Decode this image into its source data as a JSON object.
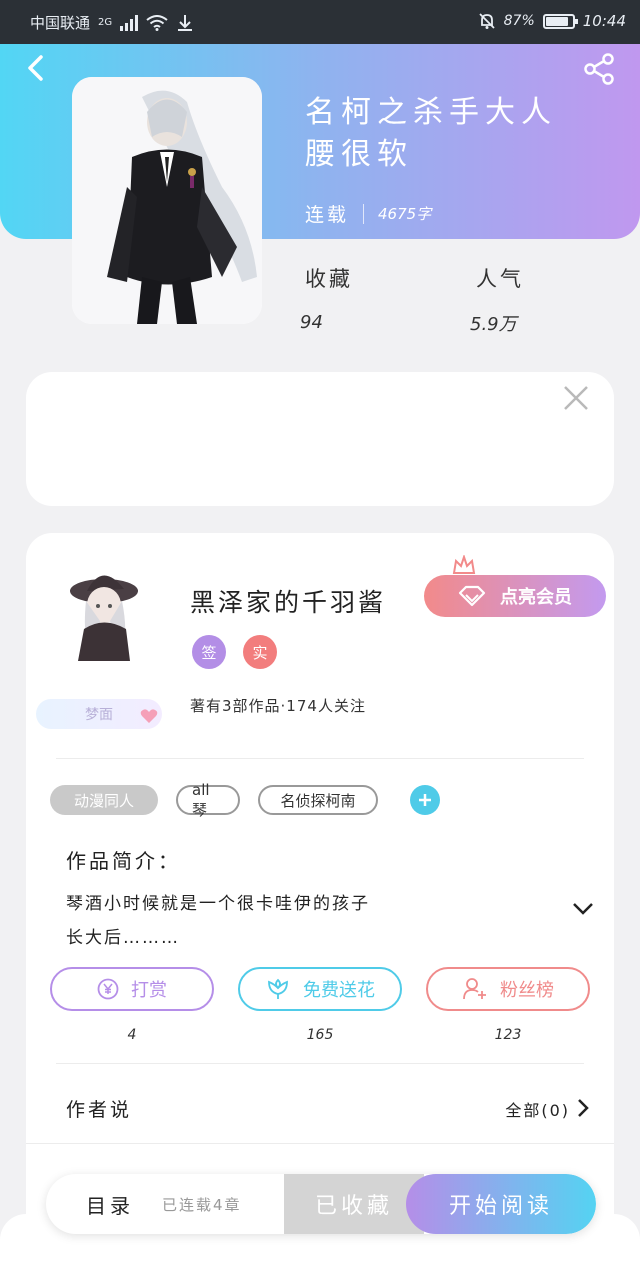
{
  "status_bar": {
    "carrier": "中国联通",
    "network": "2G",
    "battery_percent": "87%",
    "battery_level": 0.87,
    "time": "10:44"
  },
  "header": {
    "title_line1": "名柯之杀手大人",
    "title_line2": "腰很软",
    "status": "连载",
    "word_count": "4675字"
  },
  "stats": {
    "favorites_label": "收藏",
    "favorites_value": "94",
    "popularity_label": "人气",
    "popularity_value": "5.9万"
  },
  "author": {
    "name": "黑泽家的千羽酱",
    "badge_sign": "签",
    "badge_real": "实",
    "avatar_caption": "梦面",
    "member_button": "点亮会员",
    "summary": "著有3部作品·174人关注"
  },
  "tags": [
    "动漫同人",
    "all琴",
    "名侦探柯南"
  ],
  "intro": {
    "heading": "作品简介：",
    "line1": "琴酒小时候就是一个很卡哇伊的孩子",
    "line2": "长大后………"
  },
  "actions": [
    {
      "label": "打赏",
      "count": "4",
      "color": "#b58ee8"
    },
    {
      "label": "免费送花",
      "count": "165",
      "color": "#4fcbe8"
    },
    {
      "label": "粉丝榜",
      "count": "123",
      "color": "#f08b8b"
    }
  ],
  "author_note": {
    "label": "作者说",
    "all_label": "全部(0)"
  },
  "bottom_bar": {
    "catalog_label": "目录",
    "chapter_status": "已连载4章",
    "collected_label": "已收藏",
    "read_label": "开始阅读"
  },
  "colors": {
    "header_start": "#52d6f4",
    "header_end": "#c098ef",
    "member_start": "#f28a8a",
    "member_end": "#c39aef",
    "read_start": "#b58ee8",
    "read_end": "#54d3f2"
  }
}
